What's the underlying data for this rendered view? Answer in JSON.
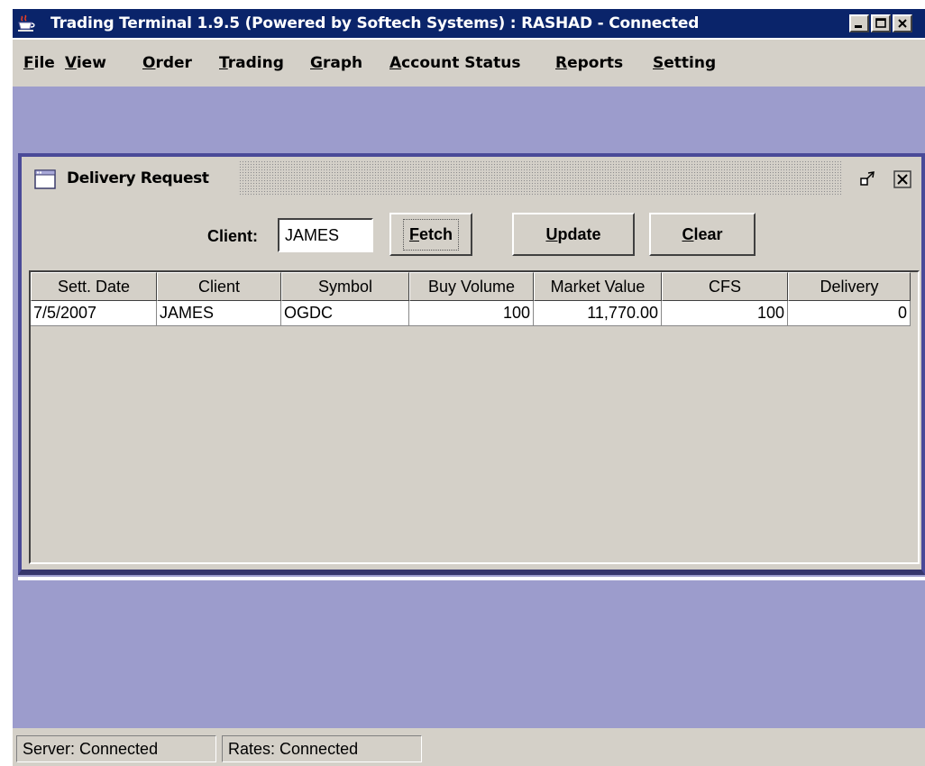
{
  "app": {
    "title": "Trading Terminal 1.9.5 (Powered by Softech Systems)   :   RASHAD - Connected"
  },
  "menu": [
    {
      "label": "File",
      "mnemonic": "F"
    },
    {
      "label": "View",
      "mnemonic": "V"
    },
    {
      "label": "Order",
      "mnemonic": "O"
    },
    {
      "label": "Trading",
      "mnemonic": "T"
    },
    {
      "label": "Graph",
      "mnemonic": "G"
    },
    {
      "label": "Account Status",
      "mnemonic": "A"
    },
    {
      "label": "Reports",
      "mnemonic": "R"
    },
    {
      "label": "Setting",
      "mnemonic": "S"
    }
  ],
  "dialog": {
    "title": "Delivery Request",
    "client_label": "Client:",
    "client_value": "JAMES",
    "buttons": {
      "fetch": "Fetch",
      "update": "Update",
      "clear": "Clear"
    },
    "table": {
      "columns": [
        "Sett. Date",
        "Client",
        "Symbol",
        "Buy Volume",
        "Market Value",
        "CFS",
        "Delivery"
      ],
      "rows": [
        [
          "7/5/2007",
          "JAMES",
          "OGDC",
          "100",
          "11,770.00",
          "100",
          "0"
        ]
      ]
    }
  },
  "status": {
    "server": "Server: Connected",
    "rates": "Rates: Connected"
  },
  "colors": {
    "titlebar": "#0a246a",
    "desktop": "#9c9ccc",
    "panel": "#d4d0c8",
    "frame_border": "#4a4a98"
  },
  "icons": [
    "java-cup-icon",
    "minimize-icon",
    "maximize-icon",
    "close-icon",
    "frame-icon",
    "restore-icon"
  ]
}
